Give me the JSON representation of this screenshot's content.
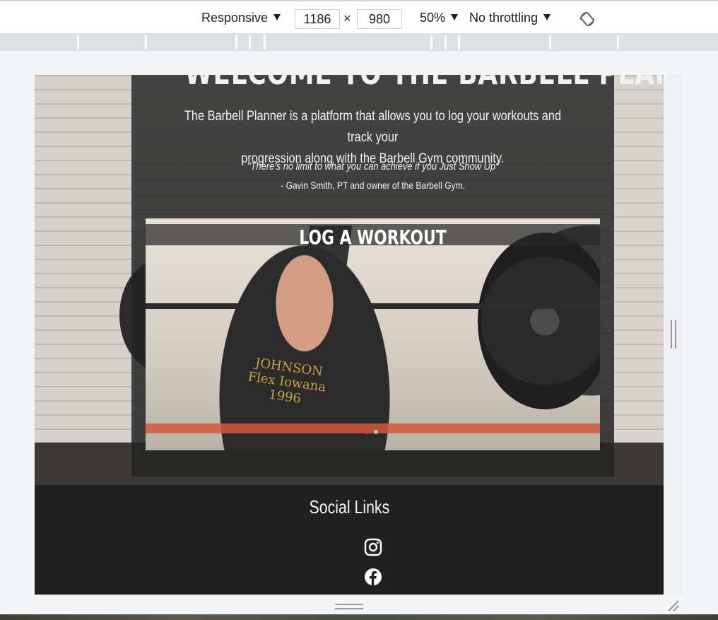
{
  "toolbar": {
    "device_label": "Responsive",
    "width_value": "1186",
    "times_symbol": "×",
    "height_value": "980",
    "zoom_label": "50%",
    "throttle_label": "No throttling",
    "rotate_icon": "rotate-icon"
  },
  "page": {
    "welcome_title": "WELCOME TO THE BARBELL PLANNER",
    "intro_line1": "The Barbell Planner is a platform that allows you to log your workouts and track your",
    "intro_line2": "progression along with the Barbell Gym community.",
    "quote": "\"There's no limit to what you can achieve if you Just Show Up\"",
    "quote_author": "- Gavin Smith, PT and owner of the Barbell Gym.",
    "carousel": {
      "caption": "LOG A WORKOUT",
      "shirt_text": "JOHNSON Flex Iowana 1996",
      "active_dot_color": "#e53935",
      "inactive_dot_color": "#bdbdbd"
    }
  },
  "footer": {
    "social_title": "Social Links",
    "icons": [
      "instagram-icon",
      "facebook-icon"
    ]
  }
}
